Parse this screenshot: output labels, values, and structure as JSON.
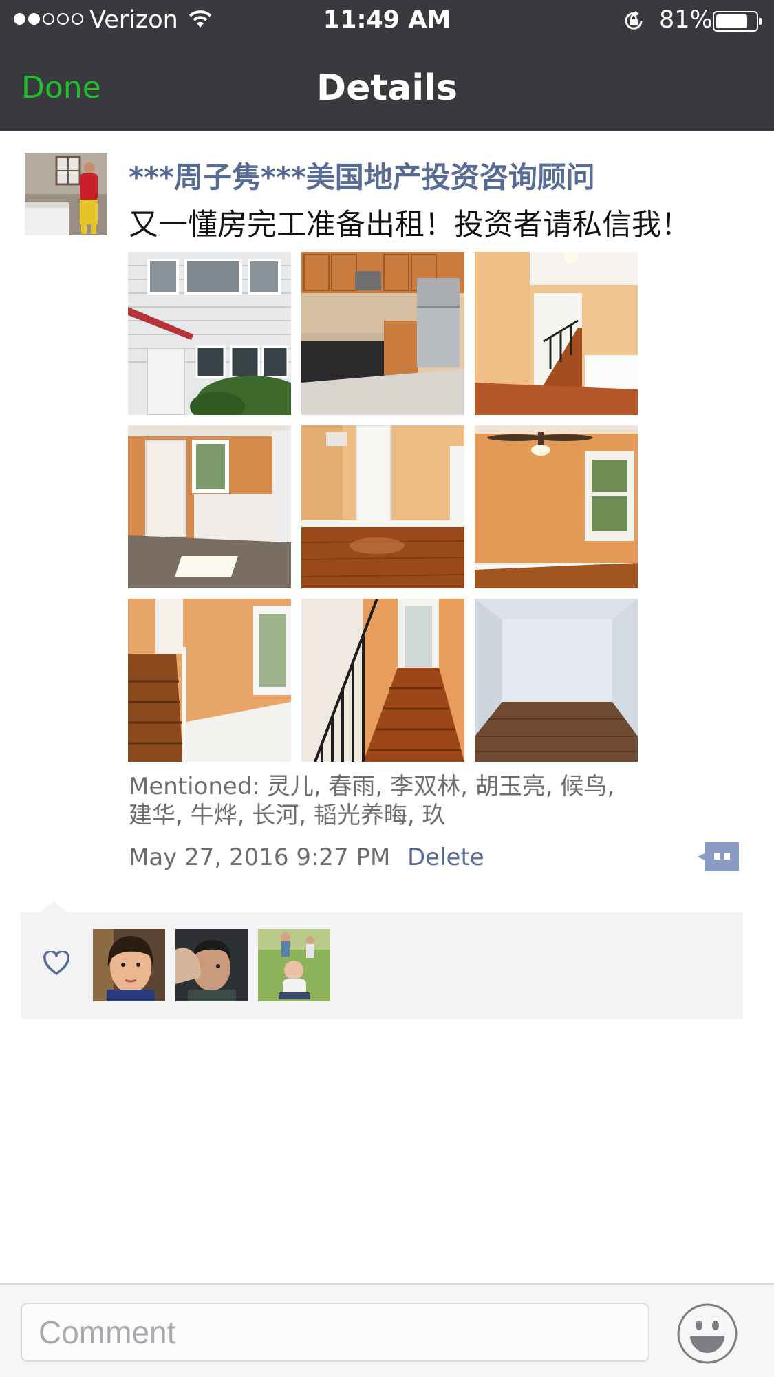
{
  "status_bar": {
    "carrier": "Verizon",
    "time": "11:49 AM",
    "battery_percent": "81%",
    "battery_level": 0.81
  },
  "nav": {
    "back_label": "Done",
    "title": "Details"
  },
  "post": {
    "author": "***周子隽***美国地产投资咨询顾问",
    "text": "又一懂房完工准备出租！投资者请私信我！",
    "photos": [
      {
        "alt": "House exterior"
      },
      {
        "alt": "Kitchen"
      },
      {
        "alt": "Staircase"
      },
      {
        "alt": "Room with door"
      },
      {
        "alt": "Hardwood floor room"
      },
      {
        "alt": "Room with ceiling fan"
      },
      {
        "alt": "Stairwell"
      },
      {
        "alt": "Staircase railing"
      },
      {
        "alt": "Empty room"
      }
    ],
    "mentioned_label": "Mentioned:",
    "mentioned": "灵儿, 春雨, 李双林, 胡玉亮, 候鸟, 建华, 牛烨, 长河, 韬光养晦, 玖",
    "timestamp": "May 27, 2016 9:27 PM",
    "delete_label": "Delete"
  },
  "likes": {
    "users": [
      {
        "alt": "Woman portrait"
      },
      {
        "alt": "Man portrait"
      },
      {
        "alt": "Child on grass"
      }
    ]
  },
  "comment_bar": {
    "placeholder": "Comment"
  },
  "colors": {
    "nav_background": "#393a3e",
    "done_green": "#1fbf2e",
    "link_blue": "#576b95",
    "likes_background": "#f3f3f5"
  }
}
